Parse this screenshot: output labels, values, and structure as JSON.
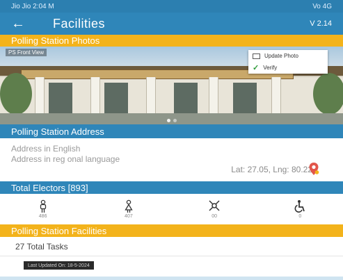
{
  "status_bar": {
    "time": "2:04",
    "left_text": "Jio Jio 2:04 M",
    "right_text": "Vo 4G"
  },
  "app_bar": {
    "back_icon": "arrow-left-icon",
    "title": "Facilities",
    "version": "V 2.14"
  },
  "photos_section": {
    "header": "Polling Station Photos",
    "caption": "PS Front View",
    "menu": {
      "update_label": "Update Photo",
      "verify_label": "Verify"
    }
  },
  "address_section": {
    "header": "Polling Station Address",
    "address_english": "Address in English",
    "address_regional": "Address in reg onal language",
    "lat_lng": "Lat: 27.05, Lng: 80.22"
  },
  "electors_section": {
    "header": "Total Electors [893]",
    "items": [
      {
        "icon": "male-icon",
        "count": "486"
      },
      {
        "icon": "female-icon",
        "count": "407"
      },
      {
        "icon": "third-gender-icon",
        "count": "00"
      },
      {
        "icon": "wheelchair-icon",
        "count": "0"
      }
    ]
  },
  "facilities_section": {
    "header": "Polling Station Facilities",
    "tasks": "27 Total Tasks",
    "last_updated": "Last Updated On: 18-5-2024"
  },
  "colors": {
    "primary": "#2f86b9",
    "accent": "#f3b31b",
    "pin": "#e2564b"
  }
}
